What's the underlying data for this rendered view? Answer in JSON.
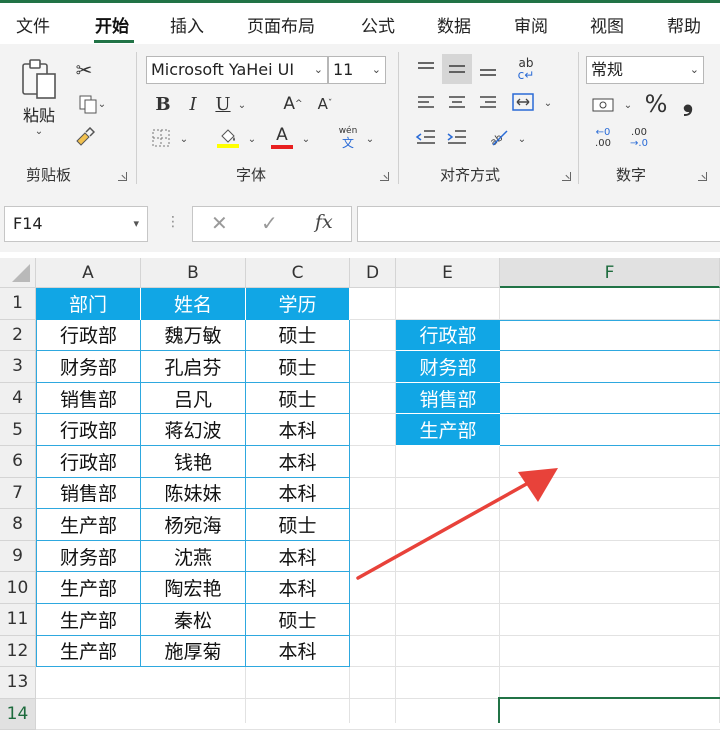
{
  "tabs": [
    "文件",
    "开始",
    "插入",
    "页面布局",
    "公式",
    "数据",
    "审阅",
    "视图",
    "帮助"
  ],
  "ribbon": {
    "clipboard": {
      "paste_label": "粘贴",
      "group_label": "剪贴板"
    },
    "font": {
      "font_name": "Microsoft YaHei UI",
      "font_size": "11",
      "group_label": "字体",
      "phonetic_label": "wén",
      "phonetic_char": "文"
    },
    "alignment": {
      "group_label": "对齐方式"
    },
    "number": {
      "format": "常规",
      "percent": "%",
      "comma": "❟",
      "group_label": "数字"
    }
  },
  "formula_bar": {
    "name_box": "F14",
    "formula": ""
  },
  "colors": {
    "header_fill": "#11a6e5",
    "border": "#2ea8df",
    "arrow": "#e8423a",
    "excel_green": "#217346"
  },
  "columns": [
    "A",
    "B",
    "C",
    "D",
    "E",
    "F"
  ],
  "rows": [
    "1",
    "2",
    "3",
    "4",
    "5",
    "6",
    "7",
    "8",
    "9",
    "10",
    "11",
    "12",
    "13",
    "14"
  ],
  "table": {
    "headers": [
      "部门",
      "姓名",
      "学历"
    ],
    "rows": [
      [
        "行政部",
        "魏万敏",
        "硕士"
      ],
      [
        "财务部",
        "孔启芬",
        "硕士"
      ],
      [
        "销售部",
        "吕凡",
        "硕士"
      ],
      [
        "行政部",
        "蒋幻波",
        "本科"
      ],
      [
        "行政部",
        "钱艳",
        "本科"
      ],
      [
        "销售部",
        "陈妹妹",
        "本科"
      ],
      [
        "生产部",
        "杨宛海",
        "硕士"
      ],
      [
        "财务部",
        "沈燕",
        "本科"
      ],
      [
        "生产部",
        "陶宏艳",
        "本科"
      ],
      [
        "生产部",
        "秦松",
        "硕士"
      ],
      [
        "生产部",
        "施厚菊",
        "本科"
      ]
    ]
  },
  "dept_list": [
    "行政部",
    "财务部",
    "销售部",
    "生产部"
  ]
}
